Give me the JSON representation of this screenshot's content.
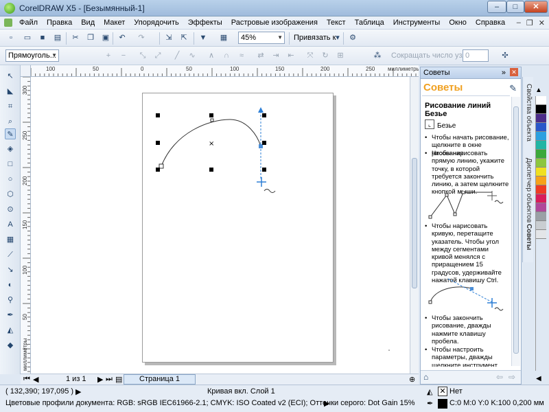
{
  "window": {
    "title": "CorelDRAW X5 - [Безымянный-1]",
    "buttons": {
      "minimize": "–",
      "maximize": "□",
      "close": "✕"
    }
  },
  "menu": {
    "items": [
      "Файл",
      "Правка",
      "Вид",
      "Макет",
      "Упорядочить",
      "Эффекты",
      "Растровые изображения",
      "Текст",
      "Таблица",
      "Инструменты",
      "Окно",
      "Справка"
    ],
    "doc_controls": {
      "minimize": "–",
      "restore": "❐",
      "close": "✕"
    }
  },
  "standard_toolbar": {
    "zoom_value": "45%",
    "snap_label": "Привязать к"
  },
  "property_bar": {
    "object_type": "Прямоуголь...",
    "reduce_nodes_label": "Сокращать число узлов",
    "reduce_nodes_value": "0"
  },
  "rulers": {
    "horizontal_ticks": [
      "100",
      "50",
      "0",
      "50",
      "100",
      "150",
      "200",
      "250"
    ],
    "horizontal_unit": "миллиметры",
    "vertical_ticks": [
      "300",
      "250",
      "200",
      "150",
      "100",
      "50",
      "0"
    ],
    "vertical_unit": "миллиметры"
  },
  "page_navigator": {
    "page_count": "1 из 1",
    "page_tab": "Страница 1"
  },
  "docker": {
    "header": "Советы",
    "big_title": "Советы",
    "topic": "Рисование линий Безье",
    "tool_name": "Безье",
    "tips": [
      "Чтобы начать рисование, щелкните в окне рисования.",
      "Чтобы нарисовать прямую линию, укажите точку, в которой требуется закончить линию, а затем щелкните кнопкой мыши.",
      "Чтобы нарисовать кривую, перетащите указатель. Чтобы угол между сегментами кривой менялся с приращением 15 градусов, удерживайте нажатой клавишу Ctrl.",
      "Чтобы закончить рисование, дважды нажмите клавишу пробела.",
      "Чтобы настроить параметры, дважды щелкните инструмент Безье."
    ]
  },
  "side_tabs": [
    "Свойства объекта",
    "Диспетчер объектов",
    "Советы"
  ],
  "palette_colors": [
    "#ffffff",
    "#000000",
    "#4b2c89",
    "#2a57c9",
    "#2aa0e0",
    "#21b5a4",
    "#3aa83a",
    "#8cc63f",
    "#f0e020",
    "#f6a21a",
    "#ee3b24",
    "#d81d5a",
    "#b0489a",
    "#9aa0a6",
    "#c9cdd1",
    "#e3e5e8"
  ],
  "status": {
    "coords": "( 132,390; 197,095 )",
    "object_info": "Кривая вкл. Слой 1",
    "color_profile": "Цветовые профили документа: RGB: sRGB IEC61966-2.1; CMYK: ISO Coated v2 (ECI); Оттенки серого: Dot Gain 15%",
    "fill": "Нет",
    "outline": "C:0 M:0 Y:0 K:100  0,200 мм"
  }
}
